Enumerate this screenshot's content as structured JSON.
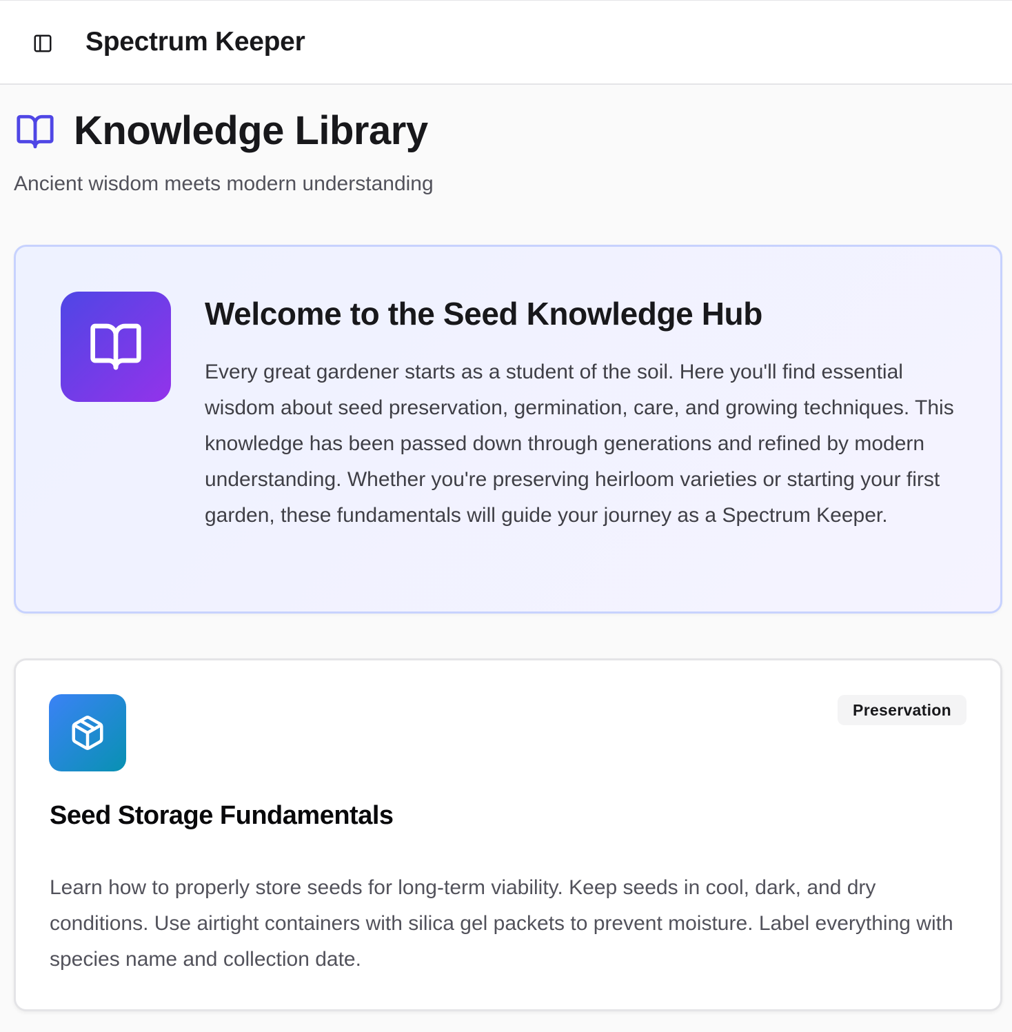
{
  "header": {
    "app_title": "Spectrum Keeper",
    "sidebar_toggle_icon": "sidebar-panel-icon"
  },
  "page": {
    "icon": "open-book-icon",
    "title": "Knowledge Library",
    "subtitle": "Ancient wisdom meets modern understanding"
  },
  "welcome": {
    "icon": "open-book-icon",
    "title": "Welcome to the Seed Knowledge Hub",
    "body": "Every great gardener starts as a student of the soil. Here you'll find essential wisdom about seed preservation, germination, care, and growing techniques. This knowledge has been passed down through generations and refined by modern understanding. Whether you're preserving heirloom varieties or starting your first garden, these fundamentals will guide your journey as a Spectrum Keeper."
  },
  "topics": [
    {
      "icon": "package-box-icon",
      "category": "Preservation",
      "title": "Seed Storage Fundamentals",
      "body": "Learn how to properly store seeds for long-term viability. Keep seeds in cool, dark, and dry conditions. Use airtight containers with silica gel packets to prevent moisture. Label everything with species name and collection date."
    }
  ],
  "colors": {
    "accent_indigo": "#4f46e5",
    "accent_purple": "#9333ea",
    "accent_blue": "#3b82f6",
    "accent_cyan": "#0891b2",
    "welcome_border": "#c7d2fe"
  }
}
